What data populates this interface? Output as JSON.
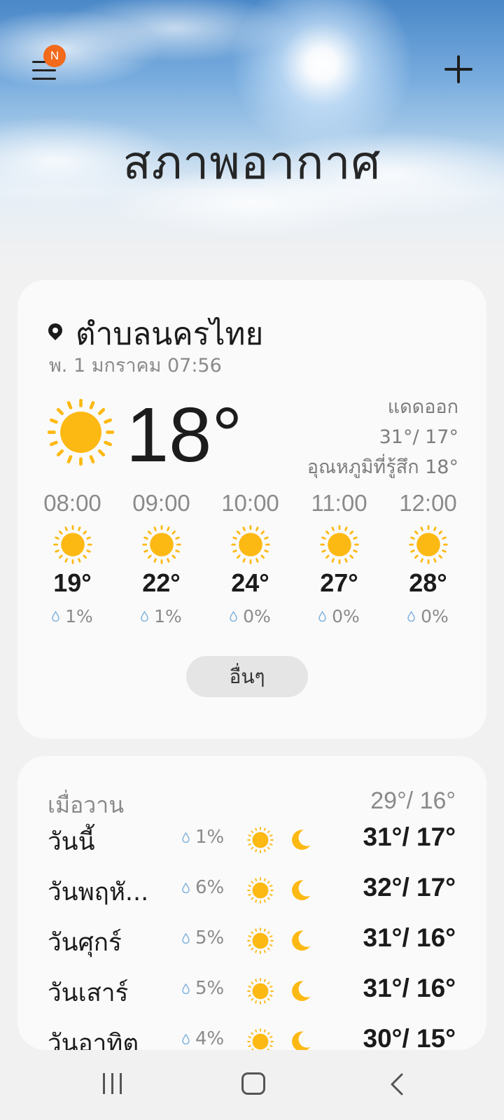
{
  "header": {
    "title": "สภาพอากาศ",
    "notification_badge": "N",
    "menu_icon": "hamburger-menu-icon",
    "add_icon": "plus-icon"
  },
  "current": {
    "location": "ตำบลนครไทย",
    "datetime": "พ. 1 มกราคม 07:56",
    "temperature": "18°",
    "condition": "แดดออก",
    "high_low": "31°/ 17°",
    "feels_like": "อุณหภูมิที่รู้สึก 18°",
    "icon": "sun-icon"
  },
  "hourly": [
    {
      "time": "08:00",
      "temp": "19°",
      "precip": "1%",
      "icon": "sun-icon"
    },
    {
      "time": "09:00",
      "temp": "22°",
      "precip": "1%",
      "icon": "sun-icon"
    },
    {
      "time": "10:00",
      "temp": "24°",
      "precip": "0%",
      "icon": "sun-icon"
    },
    {
      "time": "11:00",
      "temp": "27°",
      "precip": "0%",
      "icon": "sun-icon"
    },
    {
      "time": "12:00",
      "temp": "28°",
      "precip": "0%",
      "icon": "sun-icon"
    }
  ],
  "more_label": "อื่นๆ",
  "daily": {
    "yesterday_label": "เมื่อวาน",
    "yesterday_temps": "29°/ 16°",
    "days": [
      {
        "name": "วันนี้",
        "precip": "1%",
        "temps": "31°/ 17°"
      },
      {
        "name": "วันพฤหั...",
        "precip": "6%",
        "temps": "32°/ 17°"
      },
      {
        "name": "วันศุกร์",
        "precip": "5%",
        "temps": "31°/ 16°"
      },
      {
        "name": "วันเสาร์",
        "precip": "5%",
        "temps": "31°/ 16°"
      },
      {
        "name": "วันอาทิต",
        "precip": "4%",
        "temps": "30°/ 15°"
      }
    ]
  },
  "colors": {
    "sun": "#fdb913",
    "badge": "#f26a1b",
    "drop": "#7fb2de"
  },
  "navbar": {
    "recent_icon": "recent-apps-icon",
    "home_icon": "home-icon",
    "back_icon": "back-icon"
  }
}
